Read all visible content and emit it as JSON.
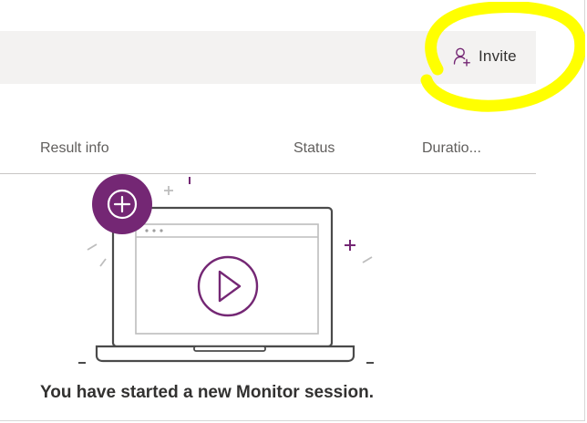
{
  "toolbar": {
    "invite_label": "Invite",
    "invite_icon": "add-person-icon"
  },
  "table": {
    "columns": [
      "Result info",
      "Status",
      "Duratio..."
    ]
  },
  "empty_state": {
    "message": "You have started a new Monitor session.",
    "icons": [
      "laptop-icon",
      "play-icon",
      "add-circle-icon"
    ]
  },
  "colors": {
    "accent": "#742774",
    "highlight": "#ffff00",
    "command_bar": "#f3f2f1",
    "divider": "#c8c6c4"
  }
}
